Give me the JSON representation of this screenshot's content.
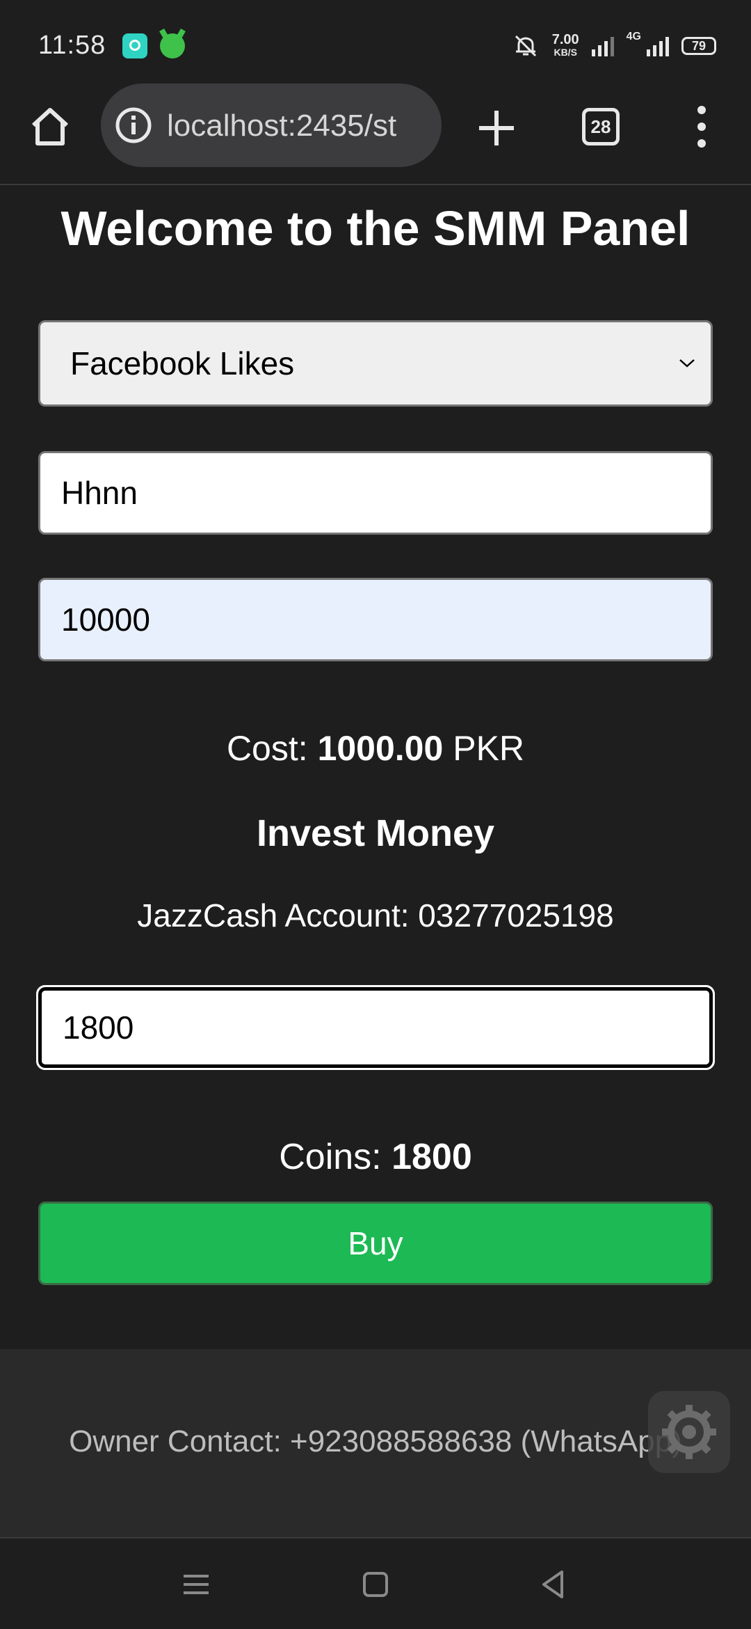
{
  "status_bar": {
    "time": "11:58",
    "net_speed_value": "7.00",
    "net_speed_unit": "KB/S",
    "network_type": "4G",
    "battery": "79",
    "icons": [
      "app-icon-teal",
      "app-icon-green-android",
      "mute-icon",
      "signal-icon",
      "signal-4g-icon",
      "battery-icon"
    ]
  },
  "browser": {
    "url": "localhost:2435/st",
    "tab_count": "28",
    "icons": [
      "home-icon",
      "info-icon",
      "plus-icon",
      "tabs-icon",
      "more-vert-icon"
    ]
  },
  "page": {
    "title": "Welcome to the SMM Panel",
    "service_select": {
      "selected": "Facebook Likes"
    },
    "link_input": {
      "value": "Hhnn"
    },
    "quantity_input": {
      "value": "10000"
    },
    "cost": {
      "label": "Cost:",
      "amount": "1000.00",
      "currency": "PKR"
    },
    "invest_heading": "Invest Money",
    "jazzcash_line": "JazzCash Account: 03277025198",
    "amount_input": {
      "value": "1800"
    },
    "coins": {
      "label": "Coins:",
      "value": "1800"
    },
    "buy_button": "Buy"
  },
  "footer": {
    "owner_contact": "Owner Contact: +923088588638 (WhatsApp)"
  },
  "colors": {
    "background": "#1e1e1e",
    "buy_button": "#1db954",
    "autofill_input": "#e8f0fe",
    "select_bg": "#efefef"
  }
}
